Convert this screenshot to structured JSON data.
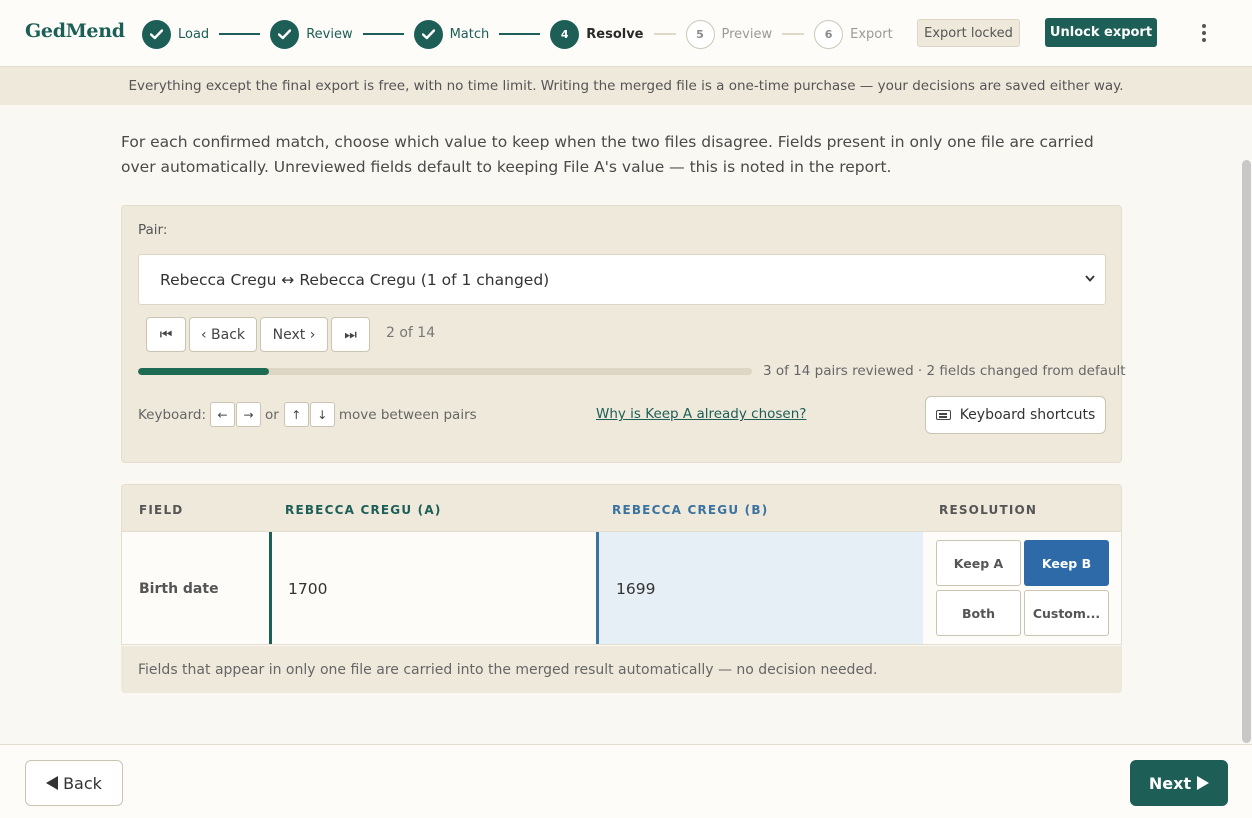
{
  "app": {
    "name": "GedMend"
  },
  "steps": [
    {
      "num": "1",
      "label": "Load",
      "state": "done"
    },
    {
      "num": "2",
      "label": "Review",
      "state": "done"
    },
    {
      "num": "3",
      "label": "Match",
      "state": "done"
    },
    {
      "num": "4",
      "label": "Resolve",
      "state": "current"
    },
    {
      "num": "5",
      "label": "Preview",
      "state": "todo"
    },
    {
      "num": "6",
      "label": "Export",
      "state": "todo"
    }
  ],
  "header": {
    "export_locked": "Export locked",
    "unlock_export": "Unlock export",
    "menu_icon": "kebab-menu-icon"
  },
  "banner": {
    "text": "Everything except the final export is free, with no time limit. Writing the merged file is a one-time purchase — your decisions are saved either way."
  },
  "intro": {
    "text": "For each confirmed match, choose which value to keep when the two files disagree. Fields present in only one file are carried over automatically. Unreviewed fields default to keeping File A's value — this is noted in the report."
  },
  "pair": {
    "label": "Pair:",
    "selected": "Rebecca Cregu ↔ Rebecca Cregu (1 of 1 changed)",
    "nav": {
      "first": "⏮",
      "back": "‹ Back",
      "next": "Next ›",
      "last": "⏭"
    },
    "position": "2 of 14",
    "progress_fraction": 0.214,
    "progress_text": "3 of 14 pairs reviewed · 2 fields changed from default",
    "keyboard": {
      "prefix": "Keyboard:",
      "left": "←",
      "right": "→",
      "or": "or",
      "up": "↑",
      "down": "↓",
      "suffix": "move between pairs"
    },
    "why_link": "Why is Keep A already chosen?",
    "shortcuts_button": "Keyboard shortcuts"
  },
  "table": {
    "headers": {
      "field": "FIELD",
      "a": "REBECCA CREGU (A)",
      "b": "REBECCA CREGU (B)",
      "resolution": "RESOLUTION"
    },
    "rows": [
      {
        "field": "Birth date",
        "a": "1700",
        "b": "1699",
        "selected": "Keep B"
      }
    ],
    "resolution_options": {
      "keep_a": "Keep A",
      "keep_b": "Keep B",
      "both": "Both",
      "custom": "Custom..."
    }
  },
  "note": {
    "text": "Fields that appear in only one file are carried into the merged result automatically — no decision needed."
  },
  "footer": {
    "back": "Back",
    "next": "Next"
  },
  "colors": {
    "accent": "#1d5e57",
    "file_b": "#2e6aa8",
    "panel": "#efe9dc"
  }
}
